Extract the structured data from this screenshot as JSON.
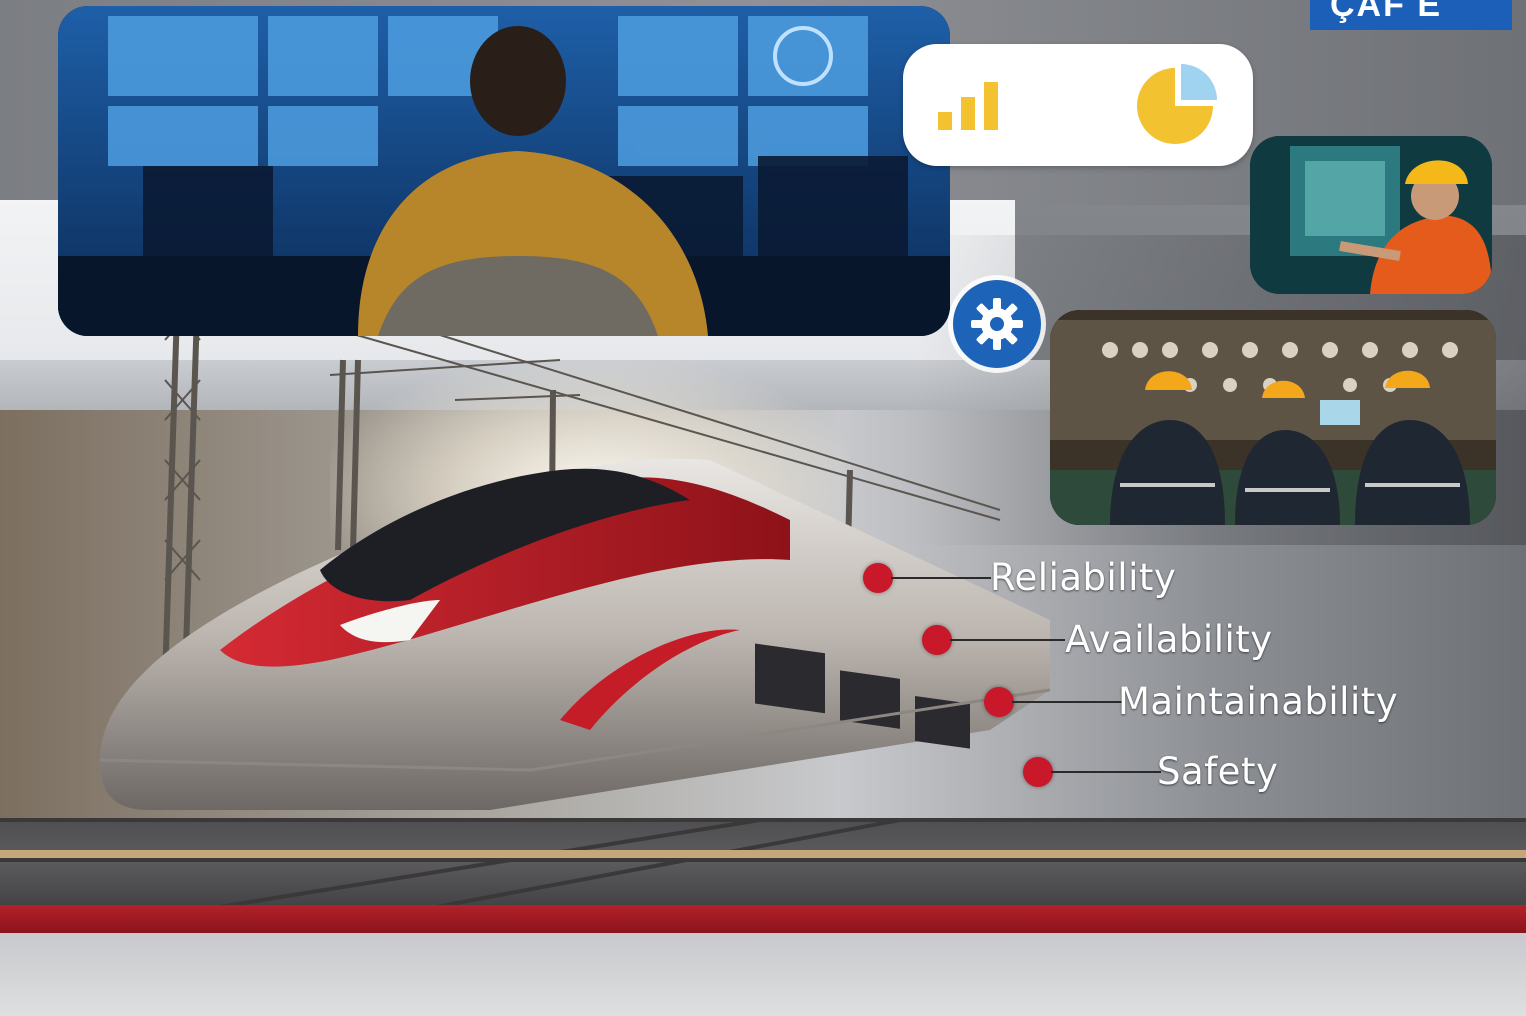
{
  "logo": {
    "text": "ÇAF E",
    "color": "#1c5fb8"
  },
  "icons": {
    "bar_chart": "bar-chart-icon",
    "pie_chart": "pie-chart-icon",
    "gear": "gear-icon"
  },
  "features": [
    {
      "label": "Reliability"
    },
    {
      "label": "Availability"
    },
    {
      "label": "Maintainability"
    },
    {
      "label": "Safety"
    }
  ],
  "colors": {
    "accent_red": "#c8182a",
    "accent_blue": "#1d63b8",
    "chart_yellow": "#f2c230",
    "chart_light_blue": "#9fd3ef"
  }
}
